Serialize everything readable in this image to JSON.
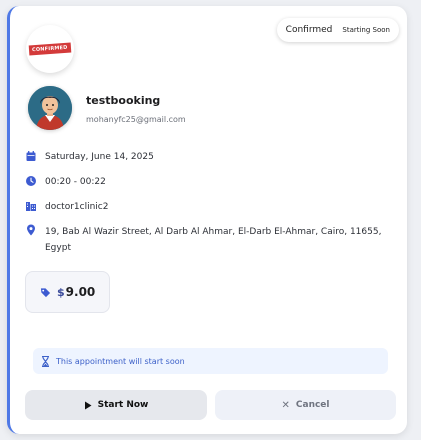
{
  "status": {
    "confirmed": "Confirmed",
    "starting": "Starting Soon"
  },
  "logo": {
    "stamp_text": "CONFIRMED"
  },
  "user": {
    "name": "testbooking",
    "email": "mohanyfc25@gmail.com"
  },
  "details": {
    "date": "Saturday, June 14, 2025",
    "time": "00:20 - 00:22",
    "clinic": "doctor1clinic2",
    "address": "19, Bab Al Wazir Street, Al Darb Al Ahmar, El-Darb El-Ahmar, Cairo, 11655, Egypt"
  },
  "price": {
    "currency": "$",
    "amount": "9.00"
  },
  "notice": "This appointment will start soon",
  "actions": {
    "start": "Start Now",
    "cancel": "Cancel"
  },
  "colors": {
    "accent": "#4f79e6",
    "icon": "#3d5bd1",
    "notice_bg": "#eef4ff"
  },
  "icons": {
    "date": "calendar-icon",
    "time": "clock-icon",
    "clinic": "building-icon",
    "address": "map-pin-icon",
    "price": "tag-icon",
    "notice": "hourglass-icon",
    "start": "play-icon",
    "cancel": "close-icon"
  }
}
